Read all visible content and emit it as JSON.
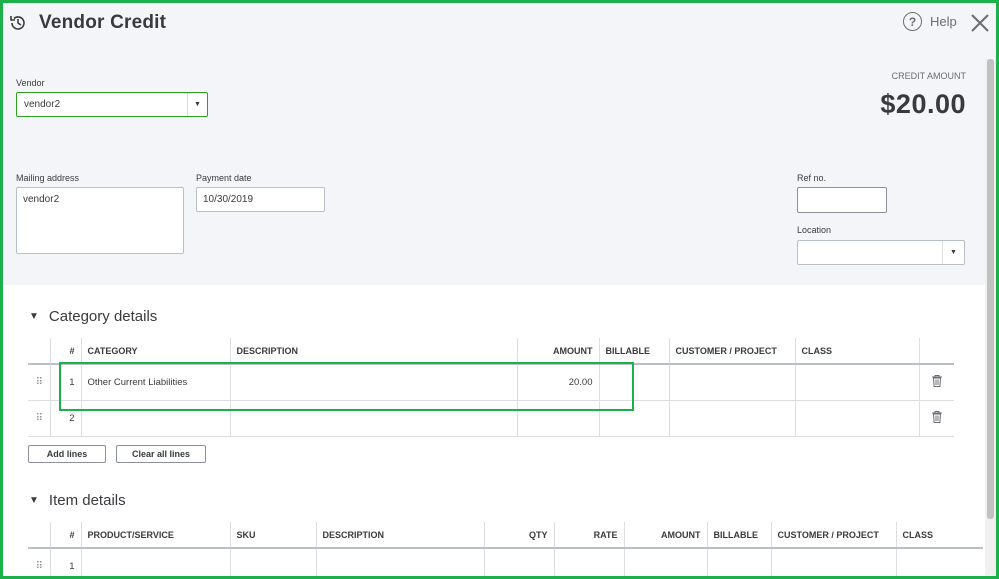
{
  "header": {
    "title": "Vendor Credit",
    "help_label": "Help",
    "icons": {
      "history": "history-icon",
      "help": "help-icon",
      "close": "close-icon"
    }
  },
  "vendor": {
    "label": "Vendor",
    "value": "vendor2"
  },
  "credit": {
    "label": "CREDIT AMOUNT",
    "amount": "$20.00"
  },
  "mailing": {
    "label": "Mailing address",
    "value": "vendor2"
  },
  "payment_date": {
    "label": "Payment date",
    "value": "10/30/2019"
  },
  "ref_no": {
    "label": "Ref no.",
    "value": ""
  },
  "location": {
    "label": "Location",
    "value": ""
  },
  "category_details": {
    "title": "Category details",
    "columns": [
      "#",
      "CATEGORY",
      "DESCRIPTION",
      "AMOUNT",
      "BILLABLE",
      "CUSTOMER / PROJECT",
      "CLASS"
    ],
    "rows": [
      {
        "num": "1",
        "category": "Other Current Liabilities",
        "description": "",
        "amount": "20.00"
      },
      {
        "num": "2",
        "category": "",
        "description": "",
        "amount": ""
      }
    ],
    "add_lines": "Add lines",
    "clear_lines": "Clear all lines"
  },
  "item_details": {
    "title": "Item details",
    "columns": [
      "#",
      "PRODUCT/SERVICE",
      "SKU",
      "DESCRIPTION",
      "QTY",
      "RATE",
      "AMOUNT",
      "BILLABLE",
      "CUSTOMER / PROJECT",
      "CLASS"
    ],
    "rows": [
      {
        "num": "1"
      }
    ]
  },
  "colors": {
    "accent_green": "#2ca01c",
    "highlight_green": "#1ab04a",
    "header_bg": "#f4f5f8",
    "text": "#393a3d"
  }
}
